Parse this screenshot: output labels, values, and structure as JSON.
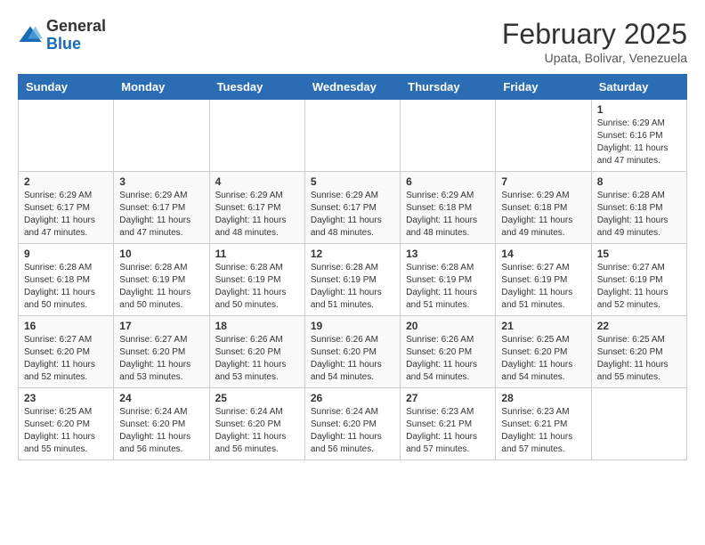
{
  "header": {
    "logo_general": "General",
    "logo_blue": "Blue",
    "month_year": "February 2025",
    "location": "Upata, Bolivar, Venezuela"
  },
  "days_of_week": [
    "Sunday",
    "Monday",
    "Tuesday",
    "Wednesday",
    "Thursday",
    "Friday",
    "Saturday"
  ],
  "weeks": [
    [
      {
        "day": "",
        "info": ""
      },
      {
        "day": "",
        "info": ""
      },
      {
        "day": "",
        "info": ""
      },
      {
        "day": "",
        "info": ""
      },
      {
        "day": "",
        "info": ""
      },
      {
        "day": "",
        "info": ""
      },
      {
        "day": "1",
        "info": "Sunrise: 6:29 AM\nSunset: 6:16 PM\nDaylight: 11 hours\nand 47 minutes."
      }
    ],
    [
      {
        "day": "2",
        "info": "Sunrise: 6:29 AM\nSunset: 6:17 PM\nDaylight: 11 hours\nand 47 minutes."
      },
      {
        "day": "3",
        "info": "Sunrise: 6:29 AM\nSunset: 6:17 PM\nDaylight: 11 hours\nand 47 minutes."
      },
      {
        "day": "4",
        "info": "Sunrise: 6:29 AM\nSunset: 6:17 PM\nDaylight: 11 hours\nand 48 minutes."
      },
      {
        "day": "5",
        "info": "Sunrise: 6:29 AM\nSunset: 6:17 PM\nDaylight: 11 hours\nand 48 minutes."
      },
      {
        "day": "6",
        "info": "Sunrise: 6:29 AM\nSunset: 6:18 PM\nDaylight: 11 hours\nand 48 minutes."
      },
      {
        "day": "7",
        "info": "Sunrise: 6:29 AM\nSunset: 6:18 PM\nDaylight: 11 hours\nand 49 minutes."
      },
      {
        "day": "8",
        "info": "Sunrise: 6:28 AM\nSunset: 6:18 PM\nDaylight: 11 hours\nand 49 minutes."
      }
    ],
    [
      {
        "day": "9",
        "info": "Sunrise: 6:28 AM\nSunset: 6:18 PM\nDaylight: 11 hours\nand 50 minutes."
      },
      {
        "day": "10",
        "info": "Sunrise: 6:28 AM\nSunset: 6:19 PM\nDaylight: 11 hours\nand 50 minutes."
      },
      {
        "day": "11",
        "info": "Sunrise: 6:28 AM\nSunset: 6:19 PM\nDaylight: 11 hours\nand 50 minutes."
      },
      {
        "day": "12",
        "info": "Sunrise: 6:28 AM\nSunset: 6:19 PM\nDaylight: 11 hours\nand 51 minutes."
      },
      {
        "day": "13",
        "info": "Sunrise: 6:28 AM\nSunset: 6:19 PM\nDaylight: 11 hours\nand 51 minutes."
      },
      {
        "day": "14",
        "info": "Sunrise: 6:27 AM\nSunset: 6:19 PM\nDaylight: 11 hours\nand 51 minutes."
      },
      {
        "day": "15",
        "info": "Sunrise: 6:27 AM\nSunset: 6:19 PM\nDaylight: 11 hours\nand 52 minutes."
      }
    ],
    [
      {
        "day": "16",
        "info": "Sunrise: 6:27 AM\nSunset: 6:20 PM\nDaylight: 11 hours\nand 52 minutes."
      },
      {
        "day": "17",
        "info": "Sunrise: 6:27 AM\nSunset: 6:20 PM\nDaylight: 11 hours\nand 53 minutes."
      },
      {
        "day": "18",
        "info": "Sunrise: 6:26 AM\nSunset: 6:20 PM\nDaylight: 11 hours\nand 53 minutes."
      },
      {
        "day": "19",
        "info": "Sunrise: 6:26 AM\nSunset: 6:20 PM\nDaylight: 11 hours\nand 54 minutes."
      },
      {
        "day": "20",
        "info": "Sunrise: 6:26 AM\nSunset: 6:20 PM\nDaylight: 11 hours\nand 54 minutes."
      },
      {
        "day": "21",
        "info": "Sunrise: 6:25 AM\nSunset: 6:20 PM\nDaylight: 11 hours\nand 54 minutes."
      },
      {
        "day": "22",
        "info": "Sunrise: 6:25 AM\nSunset: 6:20 PM\nDaylight: 11 hours\nand 55 minutes."
      }
    ],
    [
      {
        "day": "23",
        "info": "Sunrise: 6:25 AM\nSunset: 6:20 PM\nDaylight: 11 hours\nand 55 minutes."
      },
      {
        "day": "24",
        "info": "Sunrise: 6:24 AM\nSunset: 6:20 PM\nDaylight: 11 hours\nand 56 minutes."
      },
      {
        "day": "25",
        "info": "Sunrise: 6:24 AM\nSunset: 6:20 PM\nDaylight: 11 hours\nand 56 minutes."
      },
      {
        "day": "26",
        "info": "Sunrise: 6:24 AM\nSunset: 6:20 PM\nDaylight: 11 hours\nand 56 minutes."
      },
      {
        "day": "27",
        "info": "Sunrise: 6:23 AM\nSunset: 6:21 PM\nDaylight: 11 hours\nand 57 minutes."
      },
      {
        "day": "28",
        "info": "Sunrise: 6:23 AM\nSunset: 6:21 PM\nDaylight: 11 hours\nand 57 minutes."
      },
      {
        "day": "",
        "info": ""
      }
    ]
  ]
}
